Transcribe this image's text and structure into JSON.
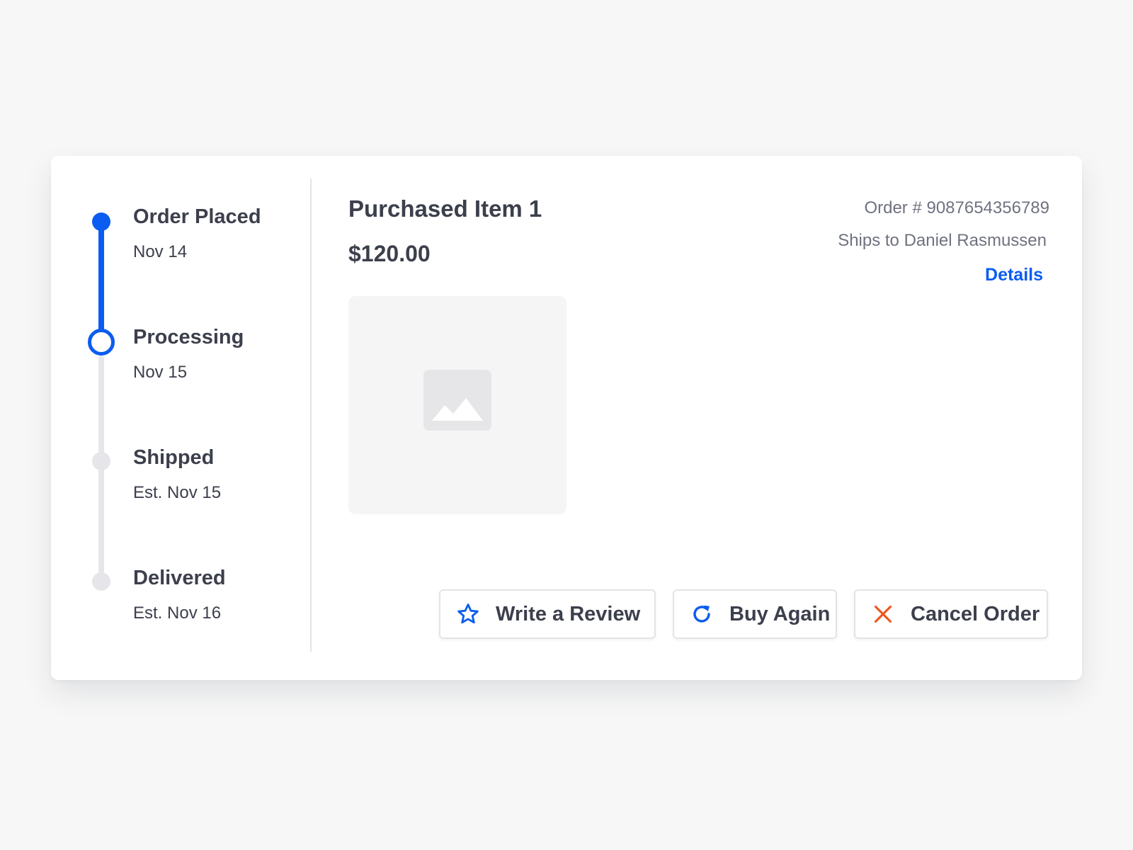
{
  "colors": {
    "accent": "#0b5cf0",
    "cancel": "#f0531c",
    "inactive": "#e6e6ea"
  },
  "timeline": {
    "steps": [
      {
        "title": "Order Placed",
        "date": "Nov 14",
        "state": "done"
      },
      {
        "title": "Processing",
        "date": "Nov 15",
        "state": "current"
      },
      {
        "title": "Shipped",
        "date": "Est. Nov 15",
        "state": "pending"
      },
      {
        "title": "Delivered",
        "date": "Est. Nov 16",
        "state": "pending"
      }
    ]
  },
  "product": {
    "title": "Purchased Item 1",
    "price": "$120.00",
    "image_icon": "image-placeholder-icon"
  },
  "order": {
    "number": "Order # 9087654356789",
    "ships_to": "Ships to Daniel Rasmussen",
    "details_label": "Details"
  },
  "actions": {
    "review": {
      "label": "Write a Review",
      "icon": "star-icon"
    },
    "again": {
      "label": "Buy Again",
      "icon": "refresh-icon"
    },
    "cancel": {
      "label": "Cancel Order",
      "icon": "close-icon"
    }
  }
}
